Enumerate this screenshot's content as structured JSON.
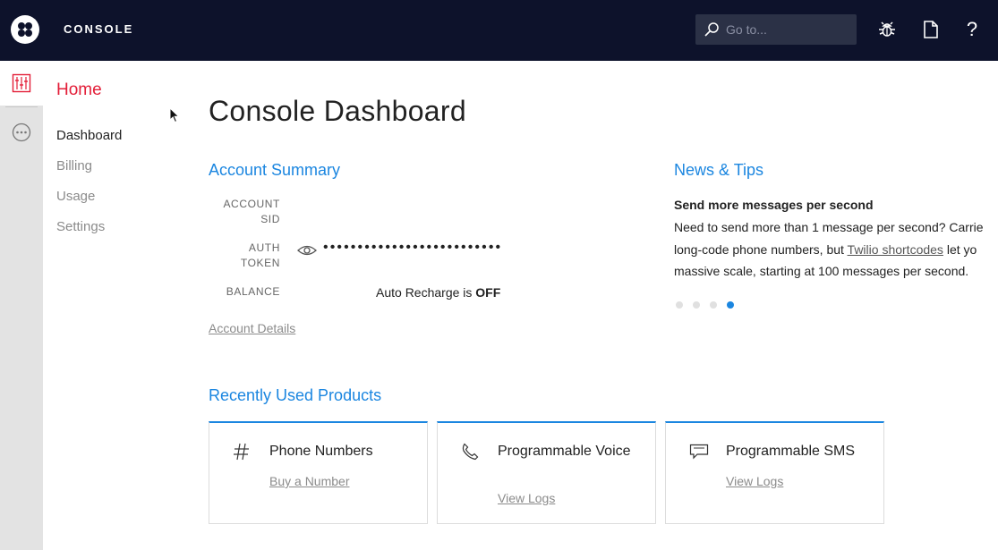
{
  "header": {
    "brand": "CONSOLE",
    "search_placeholder": "Go to...",
    "help_label": "?",
    "icons": [
      "twilio-logo-icon",
      "search-icon",
      "bug-icon",
      "document-icon",
      "help-icon"
    ]
  },
  "rail": {
    "icons": [
      "dashboard-grid-icon",
      "more-icon"
    ],
    "accent": "#e31e38"
  },
  "subnav": {
    "title": "Home",
    "items": [
      "Dashboard",
      "Billing",
      "Usage",
      "Settings"
    ]
  },
  "main": {
    "title": "Console Dashboard",
    "account_summary": {
      "title": "Account Summary",
      "sid_label_1": "ACCOUNT",
      "sid_label_2": "SID",
      "token_label_1": "AUTH",
      "token_label_2": "TOKEN",
      "token_value": "••••••••••••••••••••••••••",
      "balance_label": "BALANCE",
      "recharge_text": "Auto Recharge is ",
      "recharge_status": "OFF",
      "details_link": "Account Details"
    },
    "news": {
      "title": "News & Tips",
      "headline": "Send more messages per second",
      "line1": "Need to send more than 1 message per second? Carrie",
      "line2_pre": "long-code phone numbers, but ",
      "line2_link": "Twilio shortcodes",
      "line2_post": " let yo",
      "line3": "massive scale, starting at 100 messages per second.",
      "slide_count": 4,
      "active_slide": 4
    },
    "recent_products": {
      "title": "Recently Used Products",
      "cards": [
        {
          "name": "Phone Numbers",
          "link": "Buy a Number",
          "icon": "hash-icon"
        },
        {
          "name": "Programmable Voice",
          "link": "View Logs",
          "icon": "phone-icon"
        },
        {
          "name": "Programmable SMS",
          "link": "View Logs",
          "icon": "chat-icon"
        }
      ]
    }
  },
  "colors": {
    "topbar": "#0d122b",
    "accent_blue": "#1b86e0",
    "accent_red": "#e31e38"
  }
}
